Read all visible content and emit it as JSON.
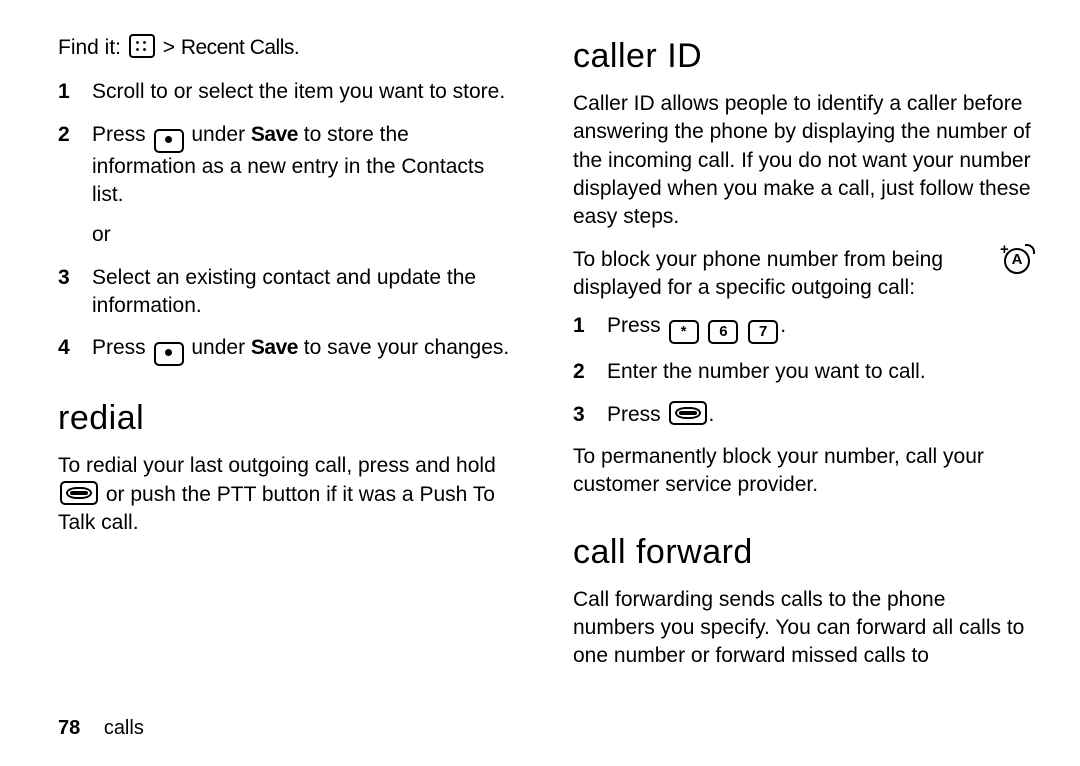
{
  "left": {
    "findit_label": "Find it:",
    "findit_path": "Recent Calls",
    "steps": [
      {
        "n": "1",
        "text": "Scroll to or select the item you want to store."
      },
      {
        "n": "2",
        "pre": "Press ",
        "save": "Save",
        "post": " to store the information as a new entry in the Contacts list.",
        "or": "or"
      },
      {
        "n": "3",
        "text": "Select an existing contact and update the information."
      },
      {
        "n": "4",
        "pre": "Press ",
        "save": "Save",
        "post": " to save your changes."
      }
    ],
    "redial_h": "redial",
    "redial_p_pre": "To redial your last outgoing call, press and hold ",
    "redial_p_post": " or push the PTT button if it was a Push To Talk call."
  },
  "right": {
    "callerid_h": "caller ID",
    "callerid_p1": "Caller ID allows people to identify a caller before answering the phone by displaying the number of the incoming call. If you do not want your number displayed when you make a call, just follow these easy steps.",
    "callerid_p2": "To block your phone number from being displayed for a specific outgoing call:",
    "keyseq": {
      "star": "*",
      "k6": "6",
      "k7": "7"
    },
    "steps": [
      {
        "n": "1",
        "pre": "Press "
      },
      {
        "n": "2",
        "text": "Enter the number you want to call."
      },
      {
        "n": "3",
        "pre": "Press "
      }
    ],
    "callerid_p3": "To permanently block your number, call your customer service provider.",
    "cf_h": "call forward",
    "cf_p": "Call forwarding sends calls to the phone numbers you specify. You can forward all calls to one number or forward missed calls to"
  },
  "footer": {
    "page": "78",
    "section": "calls"
  }
}
